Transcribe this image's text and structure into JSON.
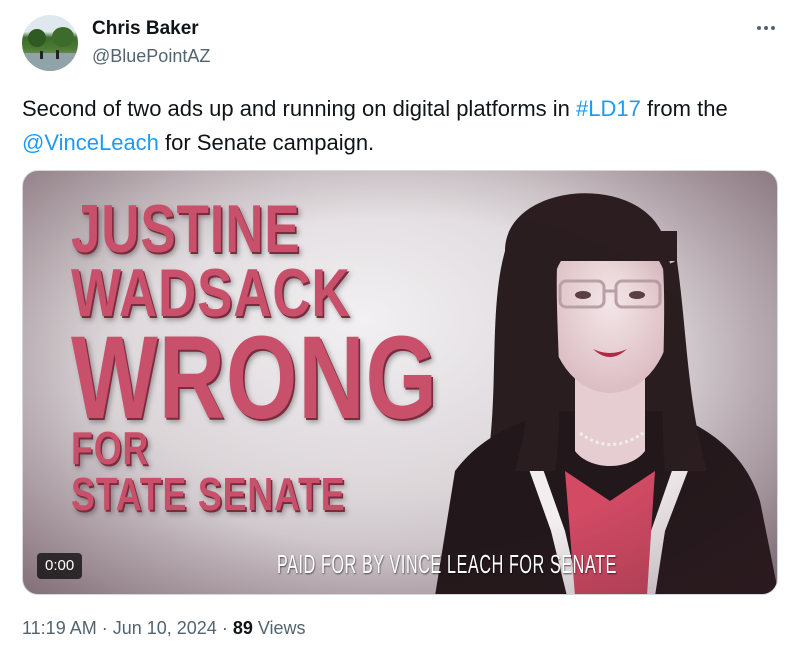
{
  "author": {
    "name": "Chris Baker",
    "handle": "@BluePointAZ"
  },
  "more_icon": "more-horizontal-icon",
  "tweet": {
    "text_1": "Second of two ads up and running on digital platforms in ",
    "hashtag": "#LD17",
    "text_2": " from the ",
    "mention": "@VinceLeach",
    "text_3": " for Senate campaign."
  },
  "media": {
    "line1": "JUSTINE",
    "line2": "WADSACK",
    "line3": "WRONG",
    "line4": "FOR",
    "line5": "STATE SENATE",
    "paid_for": "PAID FOR BY VINCE LEACH FOR SENATE",
    "timecode": "0:00",
    "accent_color": "#c8506a"
  },
  "meta": {
    "time": "11:19 AM",
    "separator": " · ",
    "date": "Jun 10, 2024",
    "views_count": "89",
    "views_label": "Views"
  }
}
